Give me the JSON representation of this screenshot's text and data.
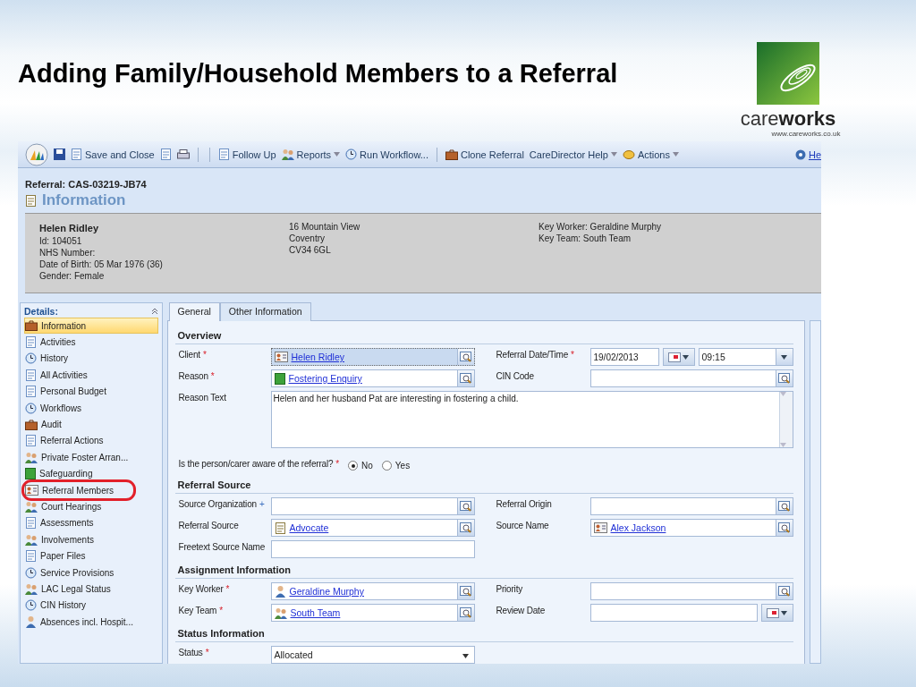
{
  "slide": {
    "title": "Adding Family/Household Members to a Referral",
    "logo_text": "care**works**",
    "logo_url": "www.careworks.co.uk"
  },
  "toolbar": {
    "items": [
      {
        "kind": "button",
        "label": "Save and Close",
        "menu": false
      },
      {
        "kind": "separator"
      },
      {
        "kind": "separator"
      },
      {
        "kind": "button",
        "label": "Follow Up",
        "menu": false
      },
      {
        "kind": "button",
        "label": "Reports",
        "menu": true
      },
      {
        "kind": "button",
        "label": "Run Workflow...",
        "menu": false
      },
      {
        "kind": "separator"
      },
      {
        "kind": "button",
        "label": "Clone Referral",
        "menu": false
      },
      {
        "kind": "button",
        "label": "CareDirector Help",
        "menu": true
      },
      {
        "kind": "button",
        "label": "Actions",
        "menu": true
      }
    ],
    "help": "He"
  },
  "header": {
    "record": "Referral: CAS-03219-JB74",
    "title": "Information"
  },
  "summary": {
    "name": "Helen Ridley",
    "details": [
      "Id: 104051",
      "NHS Number:",
      "Date of Birth: 05 Mar 1976 (36)",
      "Gender: Female"
    ],
    "address": [
      "16 Mountain View",
      "Coventry",
      "CV34 6GL"
    ],
    "team": [
      "Key Worker: Geraldine Murphy",
      "Key Team: South Team"
    ]
  },
  "sidebar": {
    "title": "Details:",
    "items": [
      {
        "label": "Information",
        "selected": true,
        "circled": false
      },
      {
        "label": "Activities",
        "selected": false,
        "circled": false
      },
      {
        "label": "History",
        "selected": false,
        "circled": false
      },
      {
        "label": "All Activities",
        "selected": false,
        "circled": false
      },
      {
        "label": "Personal Budget",
        "selected": false,
        "circled": false
      },
      {
        "label": "Workflows",
        "selected": false,
        "circled": false
      },
      {
        "label": "Audit",
        "selected": false,
        "circled": false
      },
      {
        "label": "Referral Actions",
        "selected": false,
        "circled": false
      },
      {
        "label": "Private Foster Arran...",
        "selected": false,
        "circled": false
      },
      {
        "label": "Safeguarding",
        "selected": false,
        "circled": false
      },
      {
        "label": "Referral Members",
        "selected": false,
        "circled": true
      },
      {
        "label": "Court Hearings",
        "selected": false,
        "circled": false
      },
      {
        "label": "Assessments",
        "selected": false,
        "circled": false
      },
      {
        "label": "Involvements",
        "selected": false,
        "circled": false
      },
      {
        "label": "Paper Files",
        "selected": false,
        "circled": false
      },
      {
        "label": "Service Provisions",
        "selected": false,
        "circled": false
      },
      {
        "label": "LAC Legal Status",
        "selected": false,
        "circled": false
      },
      {
        "label": "CIN History",
        "selected": false,
        "circled": false
      },
      {
        "label": "Absences incl. Hospit...",
        "selected": false,
        "circled": false
      }
    ]
  },
  "tabs": [
    {
      "label": "General",
      "selected": true
    },
    {
      "label": "Other Information",
      "selected": false
    }
  ],
  "sections": [
    {
      "heading": "Overview",
      "rows": [
        {
          "kind": "pair",
          "left": {
            "label": "Client",
            "marker": {
              "kind": "required",
              "text": "*"
            },
            "field": {
              "kind": "lookup",
              "value": "Helen Ridley",
              "focused": true
            }
          },
          "right": {
            "label": "Referral Date/Time",
            "marker": {
              "kind": "required",
              "text": "*"
            },
            "field": {
              "kind": "datetime",
              "value": "19/02/2013",
              "time": "09:15"
            }
          }
        },
        {
          "kind": "pair",
          "left": {
            "label": "Reason",
            "marker": {
              "kind": "required",
              "text": "*"
            },
            "field": {
              "kind": "lookup",
              "value": "Fostering Enquiry",
              "focused": false
            }
          },
          "right": {
            "label": "CIN Code",
            "field": {
              "kind": "lookup",
              "focused": false
            }
          }
        },
        {
          "kind": "wide",
          "left": {
            "label": "Reason Text",
            "field": {
              "kind": "textarea",
              "value": "Helen and her husband Pat are interesting in fostering a child."
            }
          }
        },
        {
          "kind": "radio",
          "label": "Is the person/carer aware of the referral?",
          "marker": {
            "kind": "required",
            "text": "*"
          },
          "options": [
            {
              "label": "No",
              "selected": true
            },
            {
              "label": "Yes",
              "selected": false
            }
          ]
        }
      ]
    },
    {
      "heading": "Referral Source",
      "rows": [
        {
          "kind": "pair",
          "left": {
            "label": "Source Organization",
            "marker": {
              "kind": "recommended",
              "text": "+"
            },
            "field": {
              "kind": "lookup",
              "focused": false
            }
          },
          "right": {
            "label": "Referral Origin",
            "field": {
              "kind": "lookup",
              "focused": false
            }
          }
        },
        {
          "kind": "pair",
          "left": {
            "label": "Referral Source",
            "field": {
              "kind": "lookup",
              "value": "Advocate",
              "focused": false
            }
          },
          "right": {
            "label": "Source Name",
            "field": {
              "kind": "lookup",
              "value": "Alex Jackson",
              "focused": false
            }
          }
        },
        {
          "kind": "pair",
          "left": {
            "label": "Freetext Source Name",
            "field": {
              "kind": "text"
            }
          }
        }
      ]
    },
    {
      "heading": "Assignment Information",
      "rows": [
        {
          "kind": "pair",
          "left": {
            "label": "Key Worker",
            "marker": {
              "kind": "required",
              "text": "*"
            },
            "field": {
              "kind": "lookup",
              "value": "Geraldine Murphy",
              "focused": false
            }
          },
          "right": {
            "label": "Priority",
            "field": {
              "kind": "lookup",
              "focused": false
            }
          }
        },
        {
          "kind": "pair",
          "left": {
            "label": "Key Team",
            "marker": {
              "kind": "required",
              "text": "*"
            },
            "field": {
              "kind": "lookup",
              "value": "South Team",
              "focused": false
            }
          },
          "right": {
            "label": "Review Date",
            "field": {
              "kind": "date"
            }
          }
        }
      ]
    },
    {
      "heading": "Status Information",
      "rows": [
        {
          "kind": "pair",
          "left": {
            "label": "Status",
            "marker": {
              "kind": "required",
              "text": "*"
            },
            "field": {
              "kind": "select",
              "value": "Allocated"
            }
          }
        }
      ]
    }
  ]
}
